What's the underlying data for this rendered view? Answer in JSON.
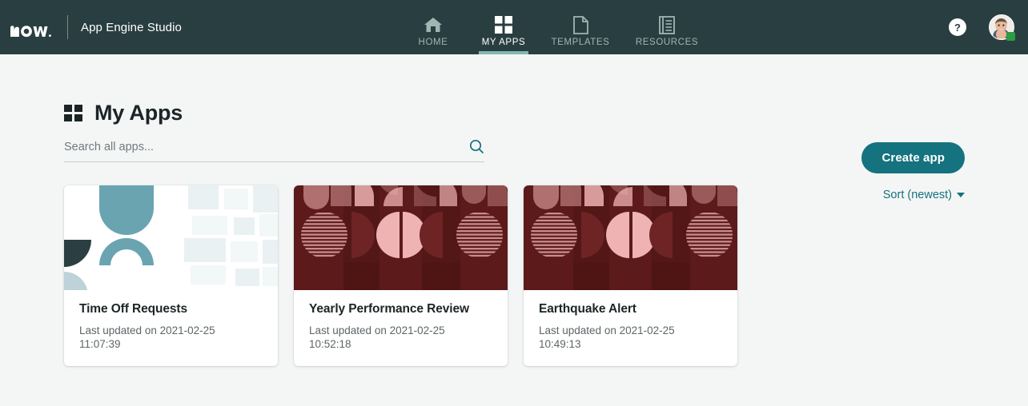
{
  "header": {
    "logo_text": "now",
    "app_title": "App Engine Studio",
    "nav": [
      {
        "id": "home",
        "label": "HOME",
        "icon": "home-icon",
        "active": false
      },
      {
        "id": "my-apps",
        "label": "MY APPS",
        "icon": "grid-icon",
        "active": true
      },
      {
        "id": "templates",
        "label": "TEMPLATES",
        "icon": "document-icon",
        "active": false
      },
      {
        "id": "resources",
        "label": "RESOURCES",
        "icon": "book-icon",
        "active": false
      }
    ],
    "help_label": "?",
    "avatar_name": "user-avatar",
    "presence": "online"
  },
  "main": {
    "page_title": "My Apps",
    "page_icon": "grid-icon",
    "search": {
      "placeholder": "Search all apps...",
      "value": "",
      "icon": "search-icon"
    },
    "create_button": "Create app",
    "sort_label": "Sort (newest)"
  },
  "apps": [
    {
      "title": "Time Off Requests",
      "subtitle": "Last updated on 2021-02-25 11:07:39",
      "art": "light-teal"
    },
    {
      "title": "Yearly Performance Review",
      "subtitle": "Last updated on 2021-02-25 10:52:18",
      "art": "maroon"
    },
    {
      "title": "Earthquake Alert",
      "subtitle": "Last updated on 2021-02-25 10:49:13",
      "art": "maroon"
    }
  ],
  "colors": {
    "header_bg": "#293e40",
    "accent_teal": "#14737e",
    "active_underline": "#84b7ab",
    "page_bg": "#f4f6f6",
    "link": "#16707c",
    "art_maroon": "#5c1a1a",
    "art_teal": "#69a4b0",
    "presence_green": "#2e9b45"
  }
}
